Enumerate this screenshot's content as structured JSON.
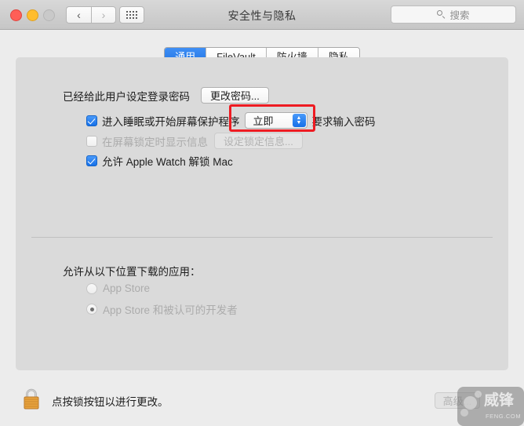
{
  "window": {
    "title": "安全性与隐私",
    "traffic_lights": [
      "close-button",
      "minimize-button",
      "zoom-button"
    ],
    "nav": {
      "back_glyph": "‹",
      "forward_glyph": "›",
      "grid_icon": "grid-icon"
    }
  },
  "search": {
    "placeholder": "搜索",
    "icon": "search-icon"
  },
  "tabs": [
    {
      "label": "通用",
      "active": true
    },
    {
      "label": "FileVault",
      "active": false
    },
    {
      "label": "防火墙",
      "active": false
    },
    {
      "label": "隐私",
      "active": false
    }
  ],
  "general": {
    "password_status": "已经给此用户设定登录密码",
    "change_password_button": "更改密码...",
    "require_password": {
      "checkbox_checked": true,
      "prefix_label": "进入睡眠或开始屏幕保护程序",
      "popup_value": "立即",
      "suffix_label": "要求输入密码",
      "stepper_up": "▲",
      "stepper_down": "▼"
    },
    "lock_message": {
      "checkbox_checked": false,
      "enabled": false,
      "label": "在屏幕锁定时显示信息",
      "button_label": "设定锁定信息..."
    },
    "apple_watch": {
      "checkbox_checked": true,
      "label": "允许 Apple Watch 解锁 Mac"
    }
  },
  "download_sources": {
    "title": "允许从以下位置下载的应用：",
    "options": [
      {
        "label": "App Store",
        "selected": false
      },
      {
        "label": "App Store 和被认可的开发者",
        "selected": true
      }
    ]
  },
  "bottom_bar": {
    "lock_icon": "lock-closed-icon",
    "status_text": "点按锁按钮以进行更改。",
    "advanced_button": "高级...",
    "advanced_enabled": false
  },
  "annotation": {
    "shape": "rectangle",
    "color": "#ee1b22",
    "target": "require-password-delay-popup"
  },
  "watermark": {
    "text_cn": "威锋",
    "text_en": "FENG.COM"
  },
  "colors": {
    "accent_blue": "#1670e8",
    "annotation_red": "#ee1b22",
    "window_bg": "#ececec",
    "panel_bg": "#dadada"
  }
}
